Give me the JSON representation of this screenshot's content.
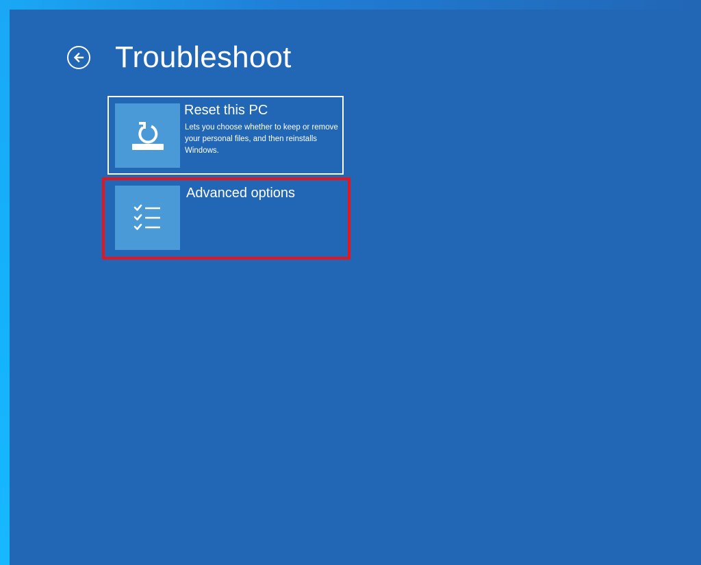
{
  "header": {
    "title": "Troubleshoot",
    "back_icon": "back-arrow-icon"
  },
  "options": [
    {
      "title": "Reset this PC",
      "description": "Lets you choose whether to keep or remove your personal files, and then reinstalls Windows.",
      "icon": "reset-pc-icon"
    },
    {
      "title": "Advanced options",
      "description": "",
      "icon": "checklist-icon",
      "highlighted": true
    }
  ],
  "colors": {
    "background": "#2266b6",
    "tile_icon_bg": "#4a9ad8",
    "highlight": "#e8141c",
    "text": "#ffffff"
  }
}
